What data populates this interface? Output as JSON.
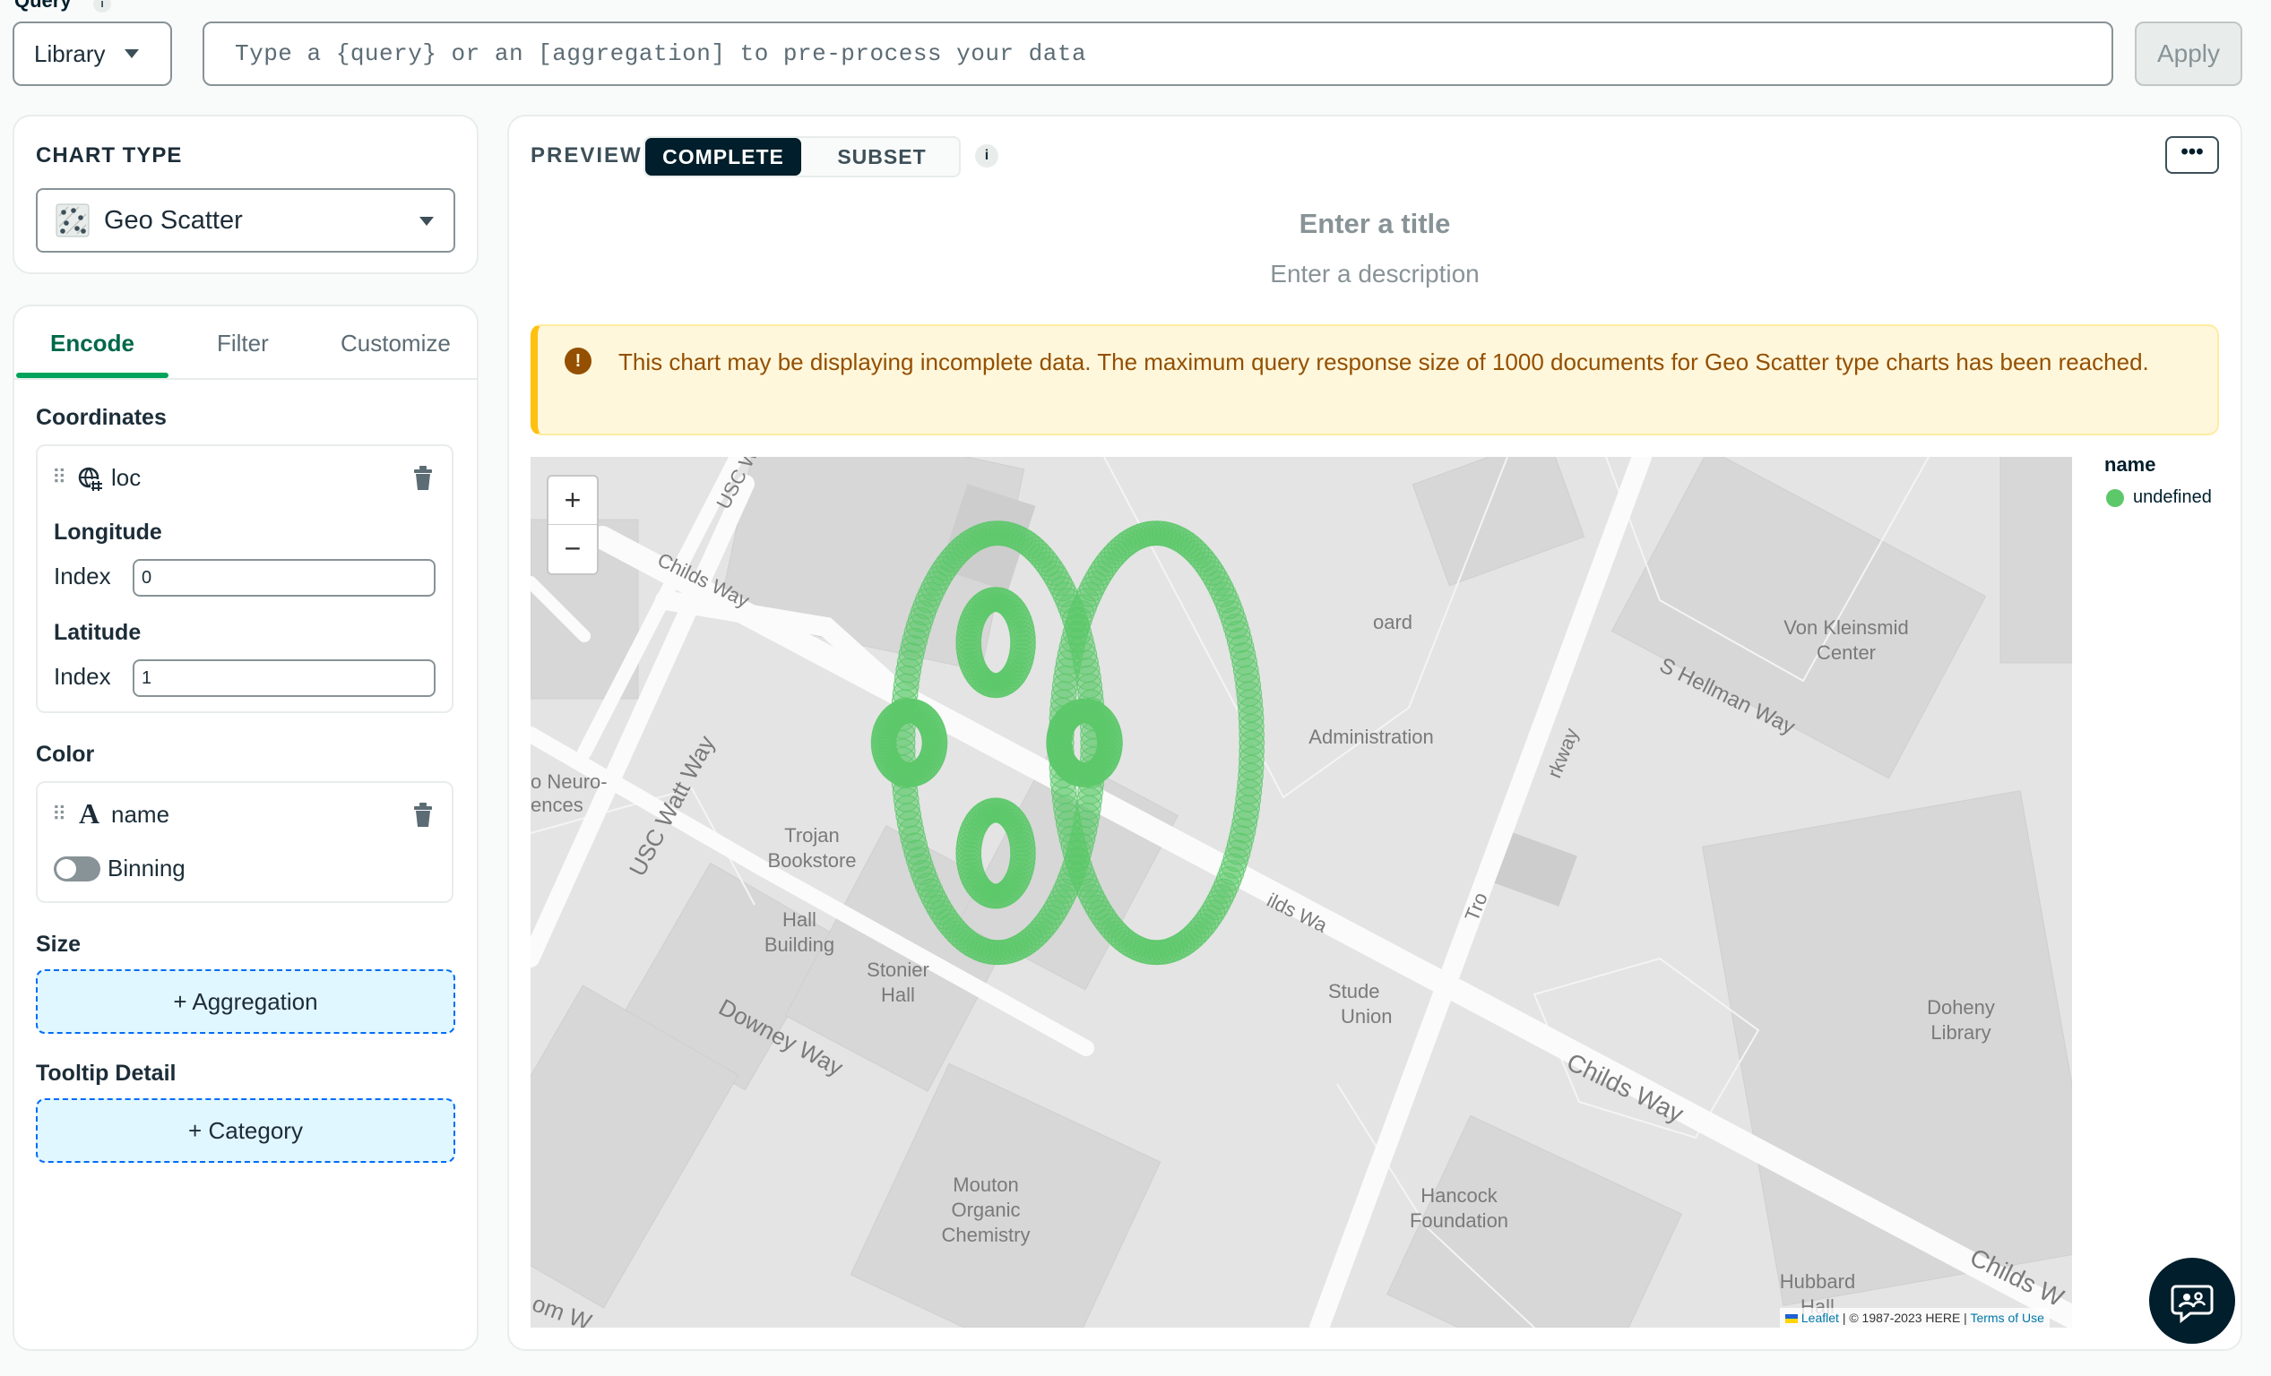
{
  "query": {
    "label": "Query",
    "info": "i",
    "source_button": "Library",
    "placeholder": "Type a {query} or an [aggregation] to pre-process your data",
    "apply": "Apply"
  },
  "chart_type": {
    "heading": "CHART TYPE",
    "selected": "Geo Scatter"
  },
  "tabs": [
    {
      "label": "Encode"
    },
    {
      "label": "Filter"
    },
    {
      "label": "Customize"
    }
  ],
  "encode": {
    "coordinates": {
      "heading": "Coordinates",
      "field": "loc",
      "longitude_heading": "Longitude",
      "longitude_index_label": "Index",
      "longitude_index_value": "0",
      "latitude_heading": "Latitude",
      "latitude_index_label": "Index",
      "latitude_index_value": "1"
    },
    "color": {
      "heading": "Color",
      "field": "name",
      "binning_label": "Binning"
    },
    "size": {
      "heading": "Size",
      "drop_label": "+ Aggregation"
    },
    "tooltip": {
      "heading": "Tooltip Detail",
      "drop_label": "+ Category"
    }
  },
  "preview": {
    "label": "PREVIEW",
    "seg_complete": "COMPLETE",
    "seg_subset": "SUBSET",
    "info": "i",
    "more": "•••",
    "title_placeholder": "Enter a title",
    "description_placeholder": "Enter a description",
    "warning_icon": "!",
    "warning": "This chart may be displaying incomplete data. The maximum query response size of 1000 documents for Geo Scatter type charts has been reached."
  },
  "map": {
    "zoom_in": "+",
    "zoom_out": "−",
    "attribution_leaflet": "Leaflet",
    "attribution_mid": " | © 1987-2023 HERE | ",
    "attribution_terms": "Terms of Use",
    "labels": {
      "usc_watt_way_top": "USC Wa",
      "childs_way_1": "Childs Way",
      "usc_watt_way": "USC Watt Way",
      "neuro": "o Neuro-",
      "ences": "ences",
      "trojan": "Trojan",
      "bookstore": "Bookstore",
      "hall": "Hall",
      "building": "Building",
      "stonier": "Stonier",
      "stonier_hall": "Hall",
      "downey_way": "Downey Way",
      "board": "oard",
      "administration": "Administration",
      "von_kleinsmid": "Von Kleinsmid",
      "center": "Center",
      "hellman_way": "S Hellman Way",
      "childs_way_mid": "ilds Wa",
      "student": "Stude",
      "union": "Union",
      "trousdale": "Tro",
      "parkway": "rkway",
      "childs_way_2": "Childs Way",
      "doheny": "Doheny",
      "library": "Library",
      "mouton": "Mouton",
      "organic": "Organic",
      "chemistry": "Chemistry",
      "hancock": "Hancock",
      "foundation": "Foundation",
      "hubbard": "Hubbard",
      "hubbard_hall": "Hall",
      "childs_way_3": "Childs W",
      "bottom_left": "om W"
    }
  },
  "legend": {
    "title": "name",
    "item": "undefined"
  },
  "colors": {
    "accent": "#00a35c",
    "point": "#5cc86a",
    "warning_bg": "#fef7db",
    "warning_text": "#944f01",
    "dark": "#001e2b"
  },
  "icons": {
    "chart_type": "geo-scatter-icon",
    "coordinates_field": "geo-field-icon",
    "color_field": "string-field-icon",
    "delete": "trash-icon",
    "chat": "chat-icon"
  }
}
